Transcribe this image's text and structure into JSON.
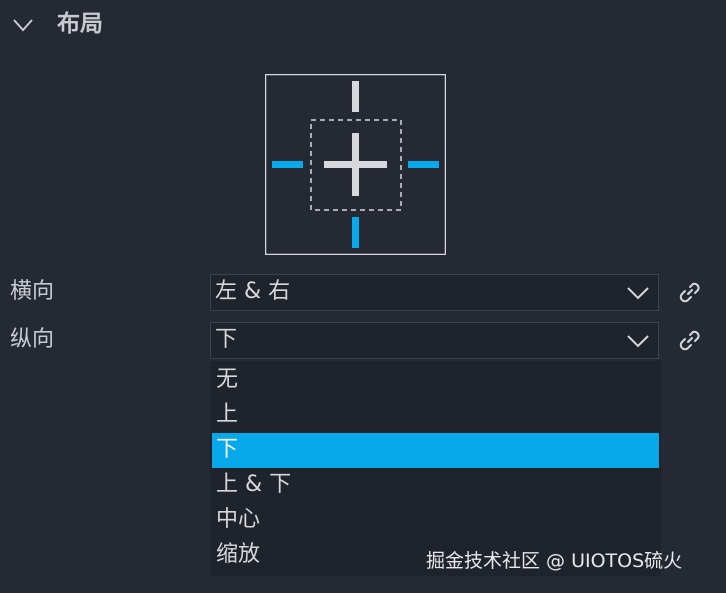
{
  "section": {
    "title": "布局"
  },
  "colors": {
    "accent": "#07a9ea",
    "background": "#242933",
    "field_background": "#1f232b",
    "field_border": "#3c4250",
    "text": "#d6d8dc"
  },
  "anchor_widget": {
    "icons": [
      "move-cross-icon",
      "anchor-top-icon",
      "anchor-bottom-icon",
      "anchor-left-icon",
      "anchor-right-icon"
    ],
    "active": [
      "left",
      "right",
      "bottom"
    ]
  },
  "horizontal": {
    "label": "横向",
    "value": "左 & 右"
  },
  "vertical": {
    "label": "纵向",
    "value": "下",
    "options": [
      "无",
      "上",
      "下",
      "上 & 下",
      "中心",
      "缩放"
    ],
    "selected_index": 2
  },
  "watermark": "掘金技术社区 @ UIOTOS硫火"
}
